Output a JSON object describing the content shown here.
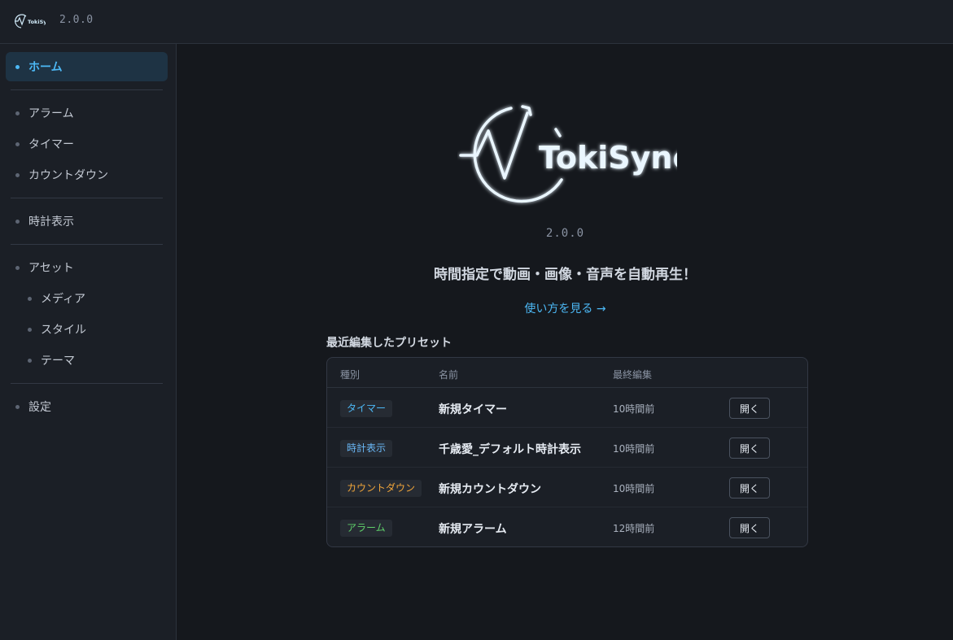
{
  "app": {
    "name": "TokiSync",
    "version": "2.0.0",
    "accent_color": "#4cb8f5"
  },
  "sidebar": {
    "items": [
      {
        "label": "ホーム",
        "active": true
      },
      {
        "label": "アラーム"
      },
      {
        "label": "タイマー"
      },
      {
        "label": "カウントダウン"
      },
      {
        "label": "時計表示"
      },
      {
        "label": "アセット"
      },
      {
        "label": "メディア"
      },
      {
        "label": "スタイル"
      },
      {
        "label": "テーマ"
      },
      {
        "label": "設定"
      }
    ]
  },
  "main": {
    "tagline": "時間指定で動画・画像・音声を自動再生！",
    "howto_link": "使い方を見る →",
    "recent_title": "最近編集したプリセット",
    "table": {
      "headers": {
        "type": "種別",
        "name": "名前",
        "edited": "最終編集"
      },
      "rows": [
        {
          "type": "タイマー",
          "type_color": "#4cb8f5",
          "name": "新規タイマー",
          "edited": "10時間前",
          "action": "開く"
        },
        {
          "type": "時計表示",
          "type_color": "#6ab8f7",
          "name": "千歳愛_デフォルト時計表示",
          "edited": "10時間前",
          "action": "開く"
        },
        {
          "type": "カウントダウン",
          "type_color": "#f0a53a",
          "name": "新規カウントダウン",
          "edited": "10時間前",
          "action": "開く"
        },
        {
          "type": "アラーム",
          "type_color": "#5fd06a",
          "name": "新規アラーム",
          "edited": "12時間前",
          "action": "開く"
        }
      ]
    }
  }
}
